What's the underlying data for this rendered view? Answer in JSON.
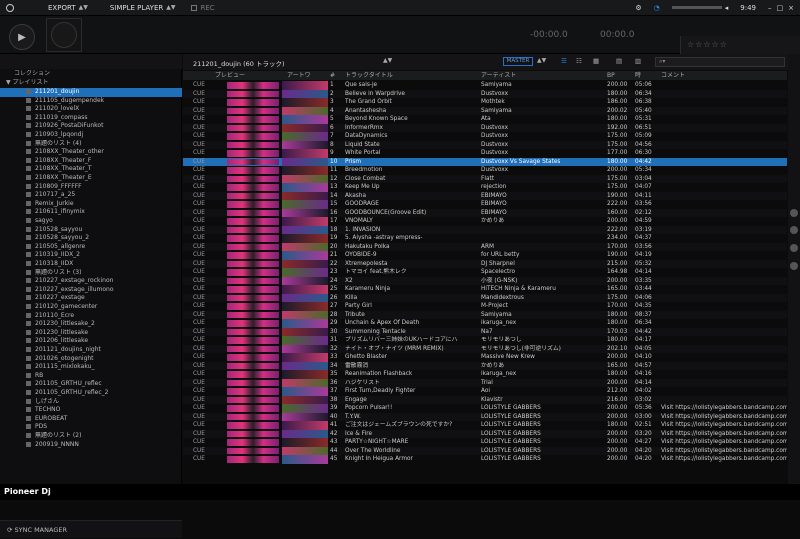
{
  "topbar": {
    "export": "EXPORT",
    "mode": "SIMPLE PLAYER",
    "rec": "REC",
    "clock": "9:49"
  },
  "player": {
    "time_left": "-00:00.0",
    "time_right": "00:00.0",
    "rating": "☆☆☆☆☆"
  },
  "sidebar": {
    "collection": "コレクション",
    "playlists": "プレイリスト",
    "items": [
      "211201_doujin",
      "211105_dugempendek",
      "211020_lovelX",
      "211019_compass",
      "210926_PostaDiFunkot",
      "210903_lpqondj",
      "無題のリスト (4)",
      "2108XX_Theater_other",
      "2108XX_Theater_F",
      "2108XX_Theater_T",
      "2108XX_Theater_E",
      "210809_FFFFFF",
      "210717_a_25",
      "Remix_Jurkie",
      "210611_ifinymix",
      "sagyo",
      "210528_sayyou",
      "210528_sayyou_2",
      "210505_allgenre",
      "210319_IIDX_2",
      "210318_IIDX",
      "無題のリスト (3)",
      "210227_exstage_rockinon",
      "210227_exstage_illumono",
      "210227_exstage",
      "210120_gamecenter",
      "210110_Ecre",
      "201230_littlesake_2",
      "201230_littlesake",
      "201206_littlesake",
      "201121_doujins_night",
      "201026_otogenight",
      "201115_mixlokaku_",
      "RB",
      "201105_GRTHU_reflec",
      "201105_GRTHU_reflec_2",
      "しげさん",
      "TECHNO",
      "EUROBEAT",
      "PDS",
      "無題のリスト (2)",
      "200919_NNNN"
    ],
    "sync": "SYNC MANAGER"
  },
  "main": {
    "playlist_title": "211201_doujin (60 トラック)",
    "master": "MASTER",
    "columns": {
      "preview": "プレビュー",
      "artwork": "アートワ",
      "num": "#",
      "title": "トラックタイトル",
      "artist": "アーティスト",
      "bpm": "BP",
      "time": "時",
      "comment": "コメント"
    }
  },
  "tracks": [
    {
      "n": "1",
      "t": "Que sais-je",
      "a": "Samiyama",
      "b": "200.00",
      "d": "05:06",
      "c": ""
    },
    {
      "n": "2",
      "t": "Believe in Warpdrive",
      "a": "Dustvoxx",
      "b": "180.00",
      "d": "06:34",
      "c": ""
    },
    {
      "n": "3",
      "t": "The Grand Orbit",
      "a": "Mothtek",
      "b": "186.00",
      "d": "06:38",
      "c": ""
    },
    {
      "n": "4",
      "t": "Anantashesha",
      "a": "Samiyama",
      "b": "200.02",
      "d": "05:40",
      "c": ""
    },
    {
      "n": "5",
      "t": "Beyond Known Space",
      "a": "Ata",
      "b": "180.00",
      "d": "05:31",
      "c": ""
    },
    {
      "n": "6",
      "t": "InformerRmx",
      "a": "Dustvoxx",
      "b": "192.00",
      "d": "06:51",
      "c": ""
    },
    {
      "n": "7",
      "t": "DataDynamics",
      "a": "Dustvoxx",
      "b": "175.00",
      "d": "05:09",
      "c": ""
    },
    {
      "n": "8",
      "t": "Liquid State",
      "a": "Dustvoxx",
      "b": "175.00",
      "d": "04:56",
      "c": ""
    },
    {
      "n": "9",
      "t": "White Portal",
      "a": "Dustvoxx",
      "b": "177.00",
      "d": "06:30",
      "c": ""
    },
    {
      "n": "10",
      "t": "Prism",
      "a": "Dustvoxx Vs Savage States",
      "b": "180.00",
      "d": "04:42",
      "c": ""
    },
    {
      "n": "11",
      "t": "Breedmotion",
      "a": "Dustvoxx",
      "b": "200.00",
      "d": "05:34",
      "c": ""
    },
    {
      "n": "12",
      "t": "Close Combat",
      "a": "Flatt",
      "b": "175.00",
      "d": "03:04",
      "c": ""
    },
    {
      "n": "13",
      "t": "Keep Me Up",
      "a": "rejection",
      "b": "175.00",
      "d": "04:07",
      "c": ""
    },
    {
      "n": "14",
      "t": "Akasha",
      "a": "EBIMAYO",
      "b": "190.00",
      "d": "04:11",
      "c": ""
    },
    {
      "n": "15",
      "t": "GOODRAGE",
      "a": "EBIMAYO",
      "b": "222.00",
      "d": "03:56",
      "c": ""
    },
    {
      "n": "16",
      "t": "GOODBOUNCE(Groove Edit)",
      "a": "EBIMAYO",
      "b": "160.00",
      "d": "02:12",
      "c": ""
    },
    {
      "n": "17",
      "t": "VNOMALY",
      "a": "かめりあ",
      "b": "200.00",
      "d": "04:59",
      "c": ""
    },
    {
      "n": "18",
      "t": "1. INVASION",
      "a": "",
      "b": "222.00",
      "d": "03:19",
      "c": ""
    },
    {
      "n": "19",
      "t": "5. Alysha -astray empress-",
      "a": "",
      "b": "234.00",
      "d": "04:37",
      "c": ""
    },
    {
      "n": "20",
      "t": "Hakutaku Polka",
      "a": "ARM",
      "b": "170.00",
      "d": "03:56",
      "c": ""
    },
    {
      "n": "21",
      "t": "OYOBIDE-9",
      "a": "for URL betty",
      "b": "190.00",
      "d": "04:19",
      "c": ""
    },
    {
      "n": "22",
      "t": "Xtremepolesta",
      "a": "DJ Sharpnel",
      "b": "215.00",
      "d": "05:32",
      "c": ""
    },
    {
      "n": "23",
      "t": "トマヨイ feat.熊木レク",
      "a": "Spacelectro",
      "b": "164.98",
      "d": "04:14",
      "c": ""
    },
    {
      "n": "24",
      "t": "X2",
      "a": "小夜 (G-NSK)",
      "b": "200.00",
      "d": "03:35",
      "c": ""
    },
    {
      "n": "25",
      "t": "Karameru Ninja",
      "a": "HiTECH Ninja & Karameru",
      "b": "165.00",
      "d": "03:44",
      "c": ""
    },
    {
      "n": "26",
      "t": "Killa",
      "a": "Mandidextrous",
      "b": "175.00",
      "d": "04:06",
      "c": ""
    },
    {
      "n": "27",
      "t": "Party Girl",
      "a": "M-Project",
      "b": "170.00",
      "d": "04:35",
      "c": ""
    },
    {
      "n": "28",
      "t": "Tribute",
      "a": "Samiyama",
      "b": "180.00",
      "d": "08:37",
      "c": ""
    },
    {
      "n": "29",
      "t": "Unchain & Apex Of Death",
      "a": "ikaruga_nex",
      "b": "180.00",
      "d": "06:34",
      "c": ""
    },
    {
      "n": "30",
      "t": "Summoning Tentacle",
      "a": "Na7",
      "b": "170.03",
      "d": "04:42",
      "c": ""
    },
    {
      "n": "31",
      "t": "プリズムリバー三姉妹のUKハードコアにハ",
      "a": "モリモリあつし",
      "b": "180.00",
      "d": "04:17",
      "c": ""
    },
    {
      "n": "32",
      "t": "ナイト・オブ・ナイツ (MRM REMIX)",
      "a": "モリモリあつし(非可逆リズム)",
      "b": "202.10",
      "d": "04:05",
      "c": ""
    },
    {
      "n": "33",
      "t": "Ghetto Blaster",
      "a": "Massive New Krew",
      "b": "200.00",
      "d": "04:10",
      "c": ""
    },
    {
      "n": "34",
      "t": "雷散霧消",
      "a": "かめりあ",
      "b": "165.00",
      "d": "04:57",
      "c": ""
    },
    {
      "n": "35",
      "t": "Reanimation Flashback",
      "a": "ikaruga_nex",
      "b": "180.00",
      "d": "04:16",
      "c": ""
    },
    {
      "n": "36",
      "t": "ハジケリスト",
      "a": "Trial",
      "b": "200.00",
      "d": "04:14",
      "c": ""
    },
    {
      "n": "37",
      "t": "First Turn,Deadly Fighter",
      "a": "Aoi",
      "b": "212.00",
      "d": "04:02",
      "c": ""
    },
    {
      "n": "38",
      "t": "Engage",
      "a": "Klavistr",
      "b": "216.00",
      "d": "03:02",
      "c": ""
    },
    {
      "n": "39",
      "t": "Popcorn Pulsar!!",
      "a": "LOLISTYLE GABBERS",
      "b": "200.00",
      "d": "05:36",
      "c": "Visit https://lolistylegabbers.bandcamp.com"
    },
    {
      "n": "40",
      "t": "T.Y.W.",
      "a": "LOLISTYLE GABBERS",
      "b": "200.00",
      "d": "03:00",
      "c": "Visit https://lolistylegabbers.bandcamp.com"
    },
    {
      "n": "41",
      "t": "ご注文はジェームズブラウンの死ですか?",
      "a": "LOLISTYLE GABBERS",
      "b": "180.00",
      "d": "02:51",
      "c": "Visit https://lolistylegabbers.bandcamp.com"
    },
    {
      "n": "42",
      "t": "Ice & Fire",
      "a": "LOLISTYLE GABBERS",
      "b": "200.00",
      "d": "03:20",
      "c": "Visit https://lolistylegabbers.bandcamp.com"
    },
    {
      "n": "43",
      "t": "PARTY☆NIGHT☆MARE",
      "a": "LOLISTYLE GABBERS",
      "b": "200.00",
      "d": "04:27",
      "c": "Visit https://lolistylegabbers.bandcamp.com"
    },
    {
      "n": "44",
      "t": "Over The Worldline",
      "a": "LOLISTYLE GABBERS",
      "b": "200.00",
      "d": "04:20",
      "c": "Visit https://lolistylegabbers.bandcamp.com"
    },
    {
      "n": "45",
      "t": "Knight In Heigua Armor",
      "a": "LOLISTYLE GABBERS",
      "b": "200.00",
      "d": "04:20",
      "c": "Visit https://lolistylegabbers.bandcamp.com"
    }
  ],
  "brand": "Pioneer Dj"
}
